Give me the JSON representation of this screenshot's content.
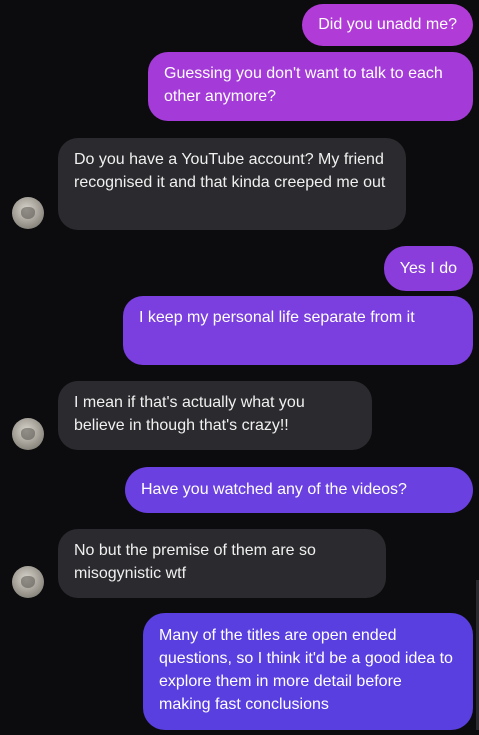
{
  "messages": [
    {
      "direction": "outgoing",
      "text": "Did you unadd me?"
    },
    {
      "direction": "outgoing",
      "text": "Guessing you don't want to talk to each other anymore?"
    },
    {
      "direction": "incoming",
      "text": "Do you have a YouTube account? My friend recognised it and that kinda creeped me out"
    },
    {
      "direction": "outgoing",
      "text": "Yes I do"
    },
    {
      "direction": "outgoing",
      "text": "I keep my personal life separate from it"
    },
    {
      "direction": "incoming",
      "text": "I mean if that's actually what you believe in though that's crazy!!"
    },
    {
      "direction": "outgoing",
      "text": "Have you watched any of the videos?"
    },
    {
      "direction": "incoming",
      "text": "No but the premise of them are so misogynistic wtf"
    },
    {
      "direction": "outgoing",
      "text": "Many of the titles are open ended questions, so I think it'd be a good idea to explore them in more detail before making fast conclusions"
    }
  ],
  "colors": {
    "background": "#0c0c0e",
    "incoming_bubble": "#2b2b2f",
    "outgoing_gradient_top": "#b13ad6",
    "outgoing_gradient_bottom": "#5a3fe0"
  },
  "icons": {
    "contact_avatar": "avatar"
  }
}
